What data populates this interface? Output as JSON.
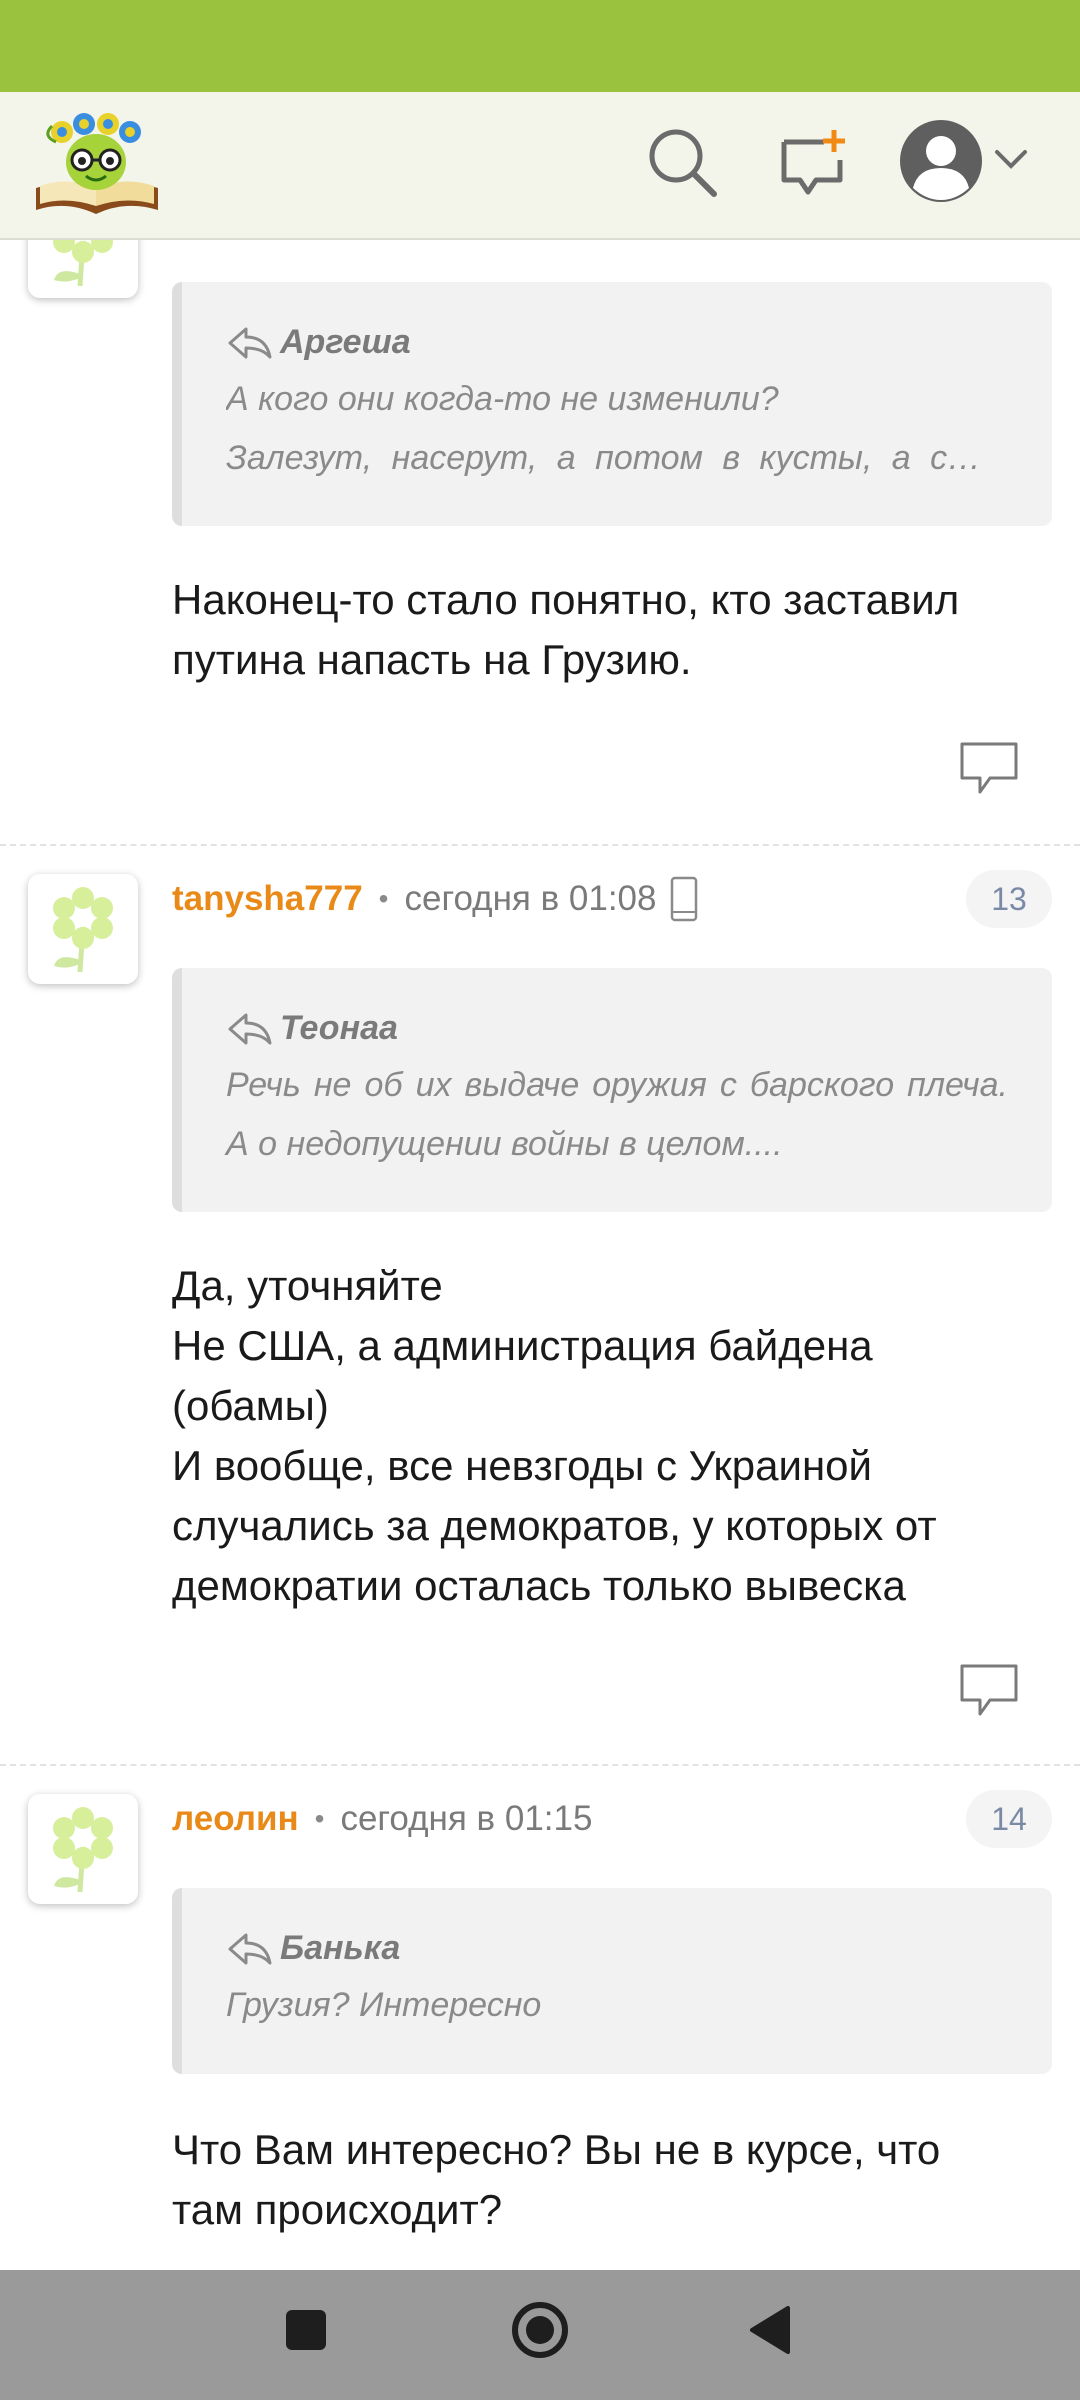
{
  "colors": {
    "status_bar": "#9bc23e",
    "header_bg": "#f3f4ea",
    "author": "#e98a18",
    "badge_text": "#7a8aa6",
    "nav_bar": "#9a9a9a"
  },
  "header": {
    "logo_icon": "bookworm-logo-icon",
    "search_icon": "search-icon",
    "new_post_icon": "new-message-icon",
    "profile_icon": "user-avatar-icon",
    "menu_icon": "chevron-down-icon"
  },
  "comments": [
    {
      "quote": {
        "author": "Аргеша",
        "lines": [
          "А кого они когда-то не изменили?",
          "Залезут, насерут, а потом в кусты, а стра..."
        ]
      },
      "body": [
        "Наконец-то стало понятно, кто заставил",
        "путина напасть на Грузию."
      ]
    },
    {
      "author": "tanysha777",
      "separator": "•",
      "time": "сегодня в 01:08",
      "number": "13",
      "quote": {
        "author": "Теонаа",
        "text": "Речь не об их выдаче оружия с барского плеча. А о недопущении войны в целом...."
      },
      "body": [
        "Да, уточняйте",
        "Не США, а администрация байдена",
        "(обамы)",
        "И вообще, все невзгоды с Украиной",
        "случались за демократов, у которых от",
        "демократии осталась только вывеска"
      ]
    },
    {
      "author": "леолин",
      "separator": "•",
      "time": "сегодня в 01:15",
      "number": "14",
      "quote": {
        "author": "Банька",
        "text": "Грузия? Интересно"
      },
      "body": [
        "Что Вам интересно? Вы не в курсе, что",
        "там происходит?"
      ]
    }
  ],
  "nav": {
    "recents_icon": "square-icon",
    "home_icon": "home-circle-icon",
    "back_icon": "back-triangle-icon"
  }
}
